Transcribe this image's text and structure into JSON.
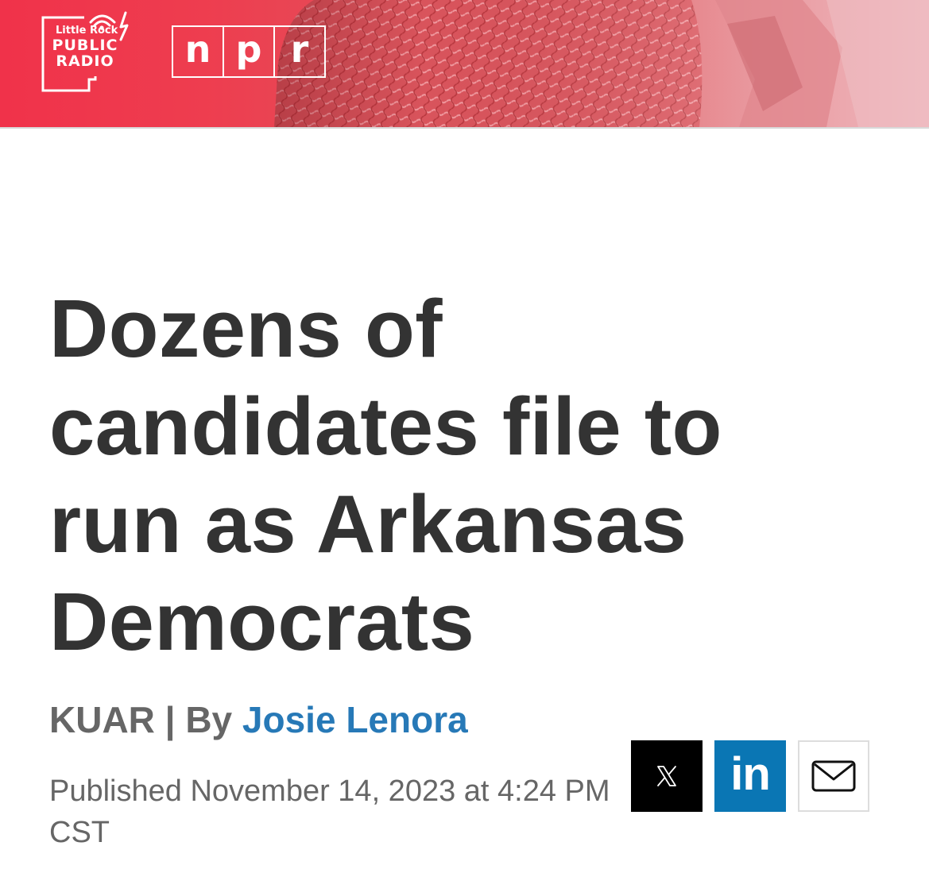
{
  "header": {
    "station_logo": {
      "line1": "Little Rock",
      "line2": "PUBLIC",
      "line3": "RADIO"
    },
    "npr_logo": {
      "letters": [
        "n",
        "p",
        "r"
      ]
    },
    "colors": {
      "banner_red": "#f0324a",
      "banner_pink": "#efb7bd"
    }
  },
  "article": {
    "headline": "Dozens of candidates file to run as Arkansas Democrats",
    "byline": {
      "source": "KUAR",
      "separator": "|",
      "by": "By",
      "author": "Josie Lenora"
    },
    "published": "Published November 14, 2023 at 4:24 PM CST",
    "colors": {
      "headline": "#333333",
      "meta": "#666666",
      "author_link": "#2779b7"
    }
  },
  "share": {
    "buttons": [
      {
        "name": "X",
        "icon": "x-icon",
        "color": "#000000"
      },
      {
        "name": "LinkedIn",
        "label": "in",
        "icon": "linkedin-icon",
        "color": "#0a76b4"
      },
      {
        "name": "Email",
        "icon": "envelope-icon",
        "color": "#ffffff"
      }
    ]
  }
}
